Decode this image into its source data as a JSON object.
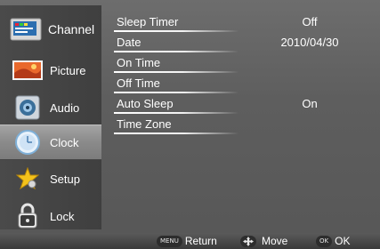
{
  "sidebar": {
    "items": [
      {
        "label": "Channel",
        "icon": "tv-channel-icon"
      },
      {
        "label": "Picture",
        "icon": "picture-icon"
      },
      {
        "label": "Audio",
        "icon": "speaker-icon"
      },
      {
        "label": "Clock",
        "icon": "clock-icon",
        "active": true
      },
      {
        "label": "Setup",
        "icon": "star-icon"
      },
      {
        "label": "Lock",
        "icon": "padlock-icon"
      }
    ]
  },
  "settings": [
    {
      "name": "Sleep Timer",
      "value": "Off"
    },
    {
      "name": "Date",
      "value": "2010/04/30"
    },
    {
      "name": "On Time",
      "value": ""
    },
    {
      "name": "Off Time",
      "value": ""
    },
    {
      "name": "Auto Sleep",
      "value": "On"
    },
    {
      "name": "Time Zone",
      "value": ""
    }
  ],
  "bottombar": {
    "menu_badge": "MENU",
    "return_label": "Return",
    "move_label": "Move",
    "ok_badge": "OK",
    "ok_label": "OK"
  },
  "colors": {
    "active_item": "#8c8c8c",
    "sidebar": "#444444",
    "background": "#5e5e5e"
  }
}
